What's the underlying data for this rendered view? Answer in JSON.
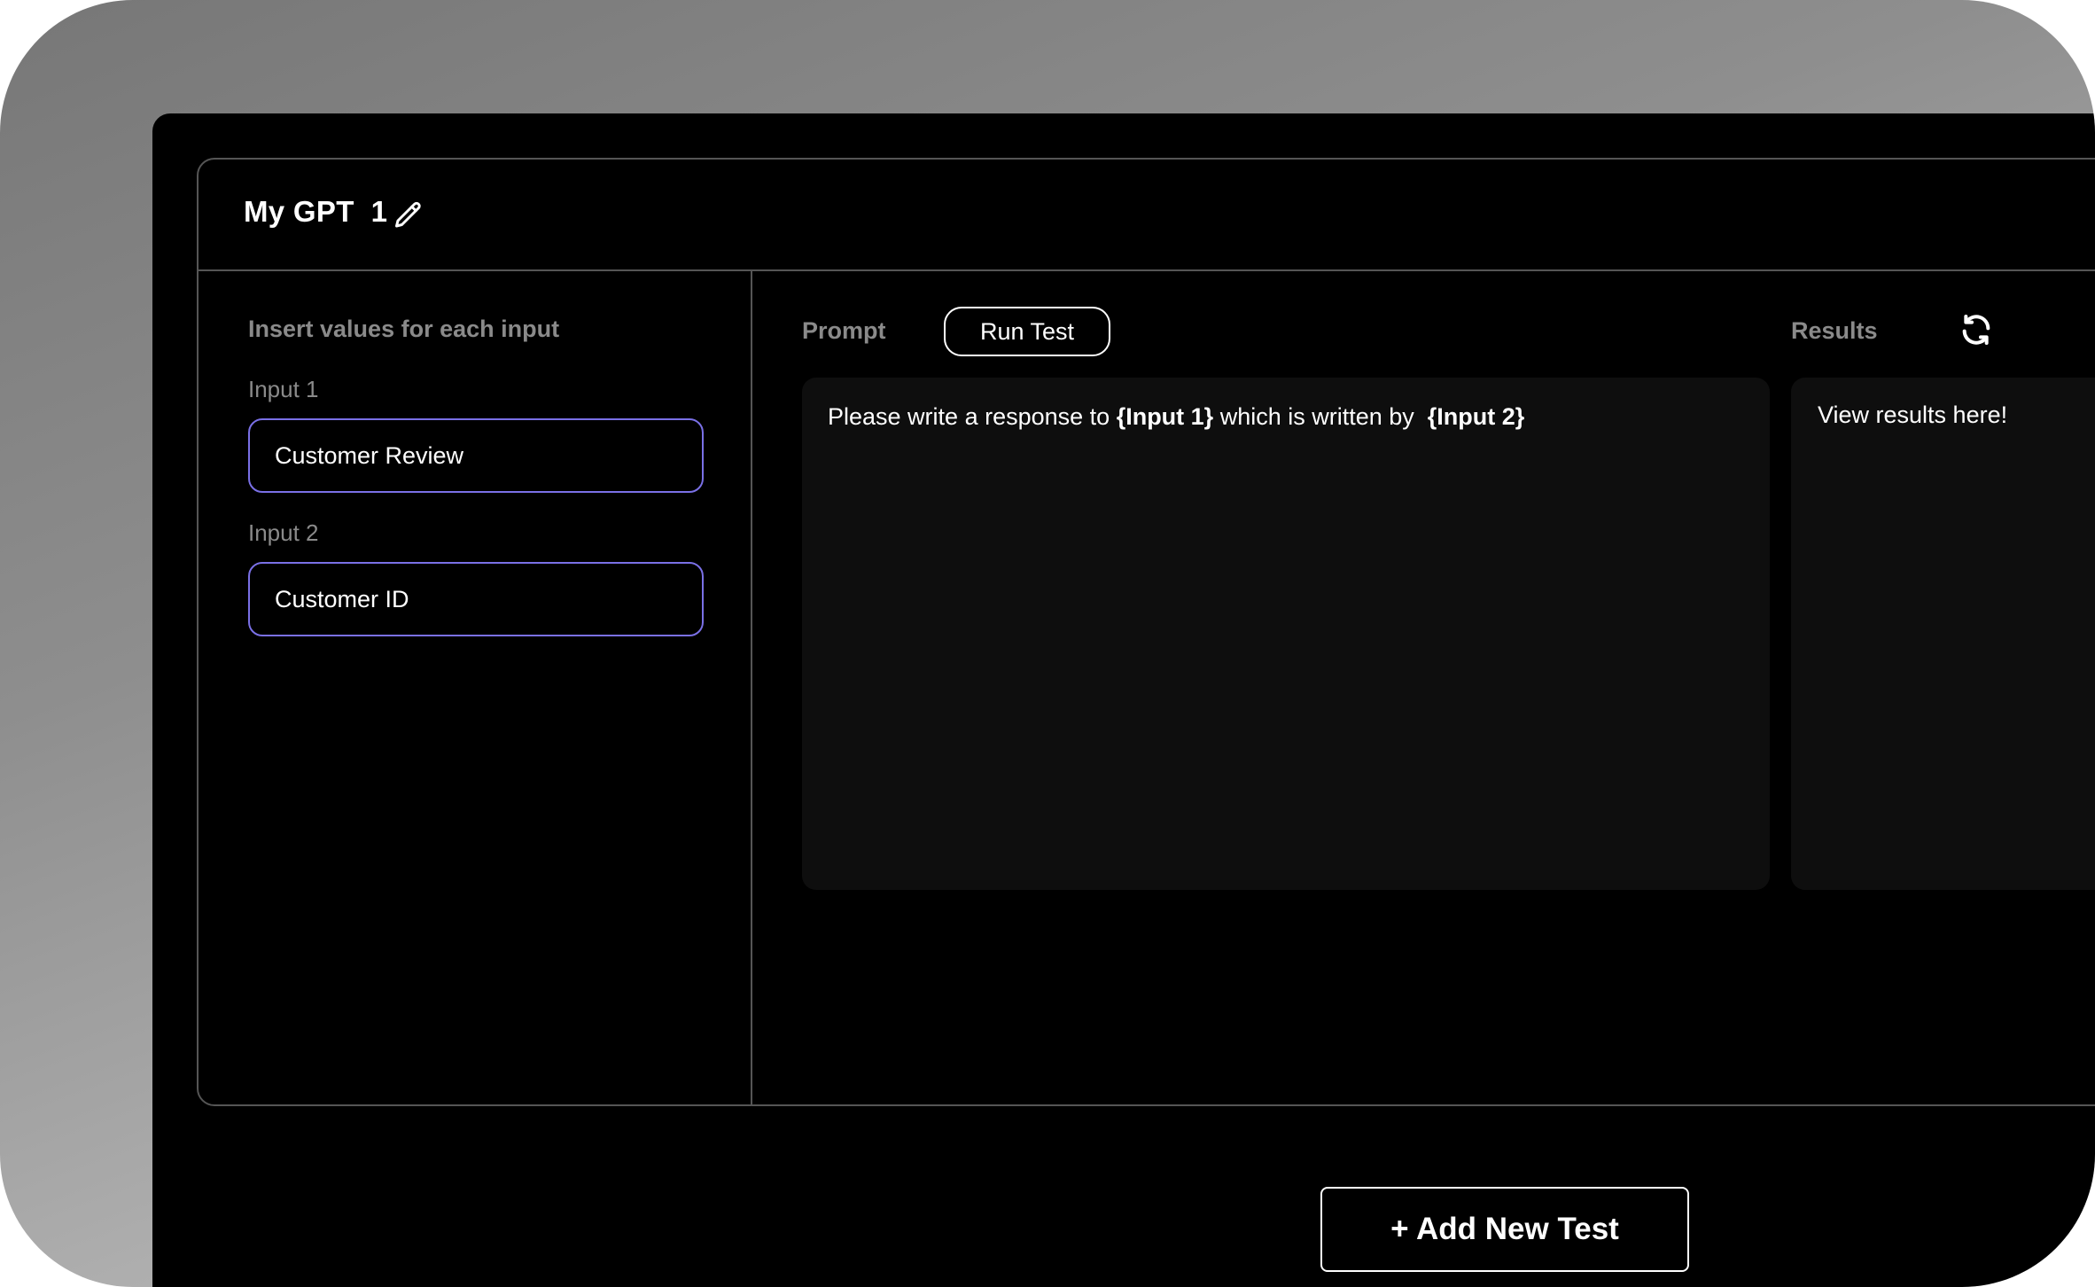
{
  "header": {
    "title": "My GPT  1",
    "edit_icon": "pencil-icon"
  },
  "inputs_panel": {
    "heading": "Insert values for each input",
    "inputs": [
      {
        "label": "Input 1",
        "value": "Customer Review"
      },
      {
        "label": "Input 2",
        "value": "Customer ID"
      }
    ]
  },
  "prompt": {
    "heading": "Prompt",
    "run_label": "Run Test",
    "text_before": "Please write a response to ",
    "var1": "{Input 1}",
    "text_middle": " which is written by ",
    "var2": "{Input 2}"
  },
  "results": {
    "heading": "Results",
    "refresh_icon": "refresh-icon",
    "placeholder_text": "View results here!"
  },
  "footer": {
    "add_label": "+ Add New Test"
  },
  "colors": {
    "input_border": "#7a70e6",
    "panel_border": "#555555",
    "box_bg": "#0e0e0e"
  }
}
